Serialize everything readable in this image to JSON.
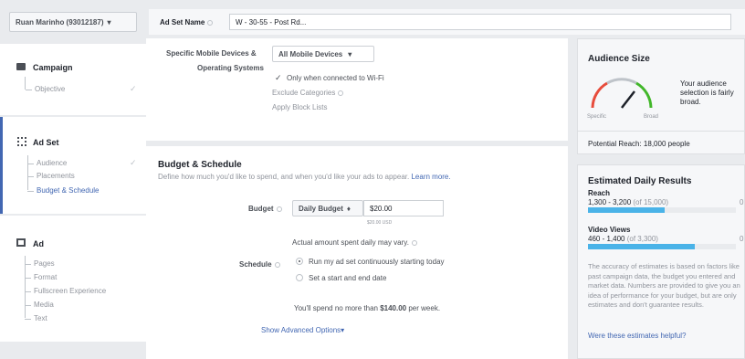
{
  "account": {
    "name": "Ruan Marinho (93012187)",
    "caret": "▾"
  },
  "header": {
    "ad_set_name_label": "Ad Set Name",
    "ad_set_name_value": "W - 30-55 - Post Rd..."
  },
  "nav": {
    "campaign": {
      "title": "Campaign",
      "children": [
        "Objective"
      ]
    },
    "adset": {
      "title": "Ad Set",
      "children": [
        "Audience",
        "Placements",
        "Budget & Schedule"
      ]
    },
    "ad": {
      "title": "Ad",
      "children": [
        "Pages",
        "Format",
        "Fullscreen Experience",
        "Media",
        "Text"
      ]
    }
  },
  "devices": {
    "label_line1": "Specific Mobile Devices &",
    "label_line2": "Operating Systems",
    "dropdown": "All Mobile Devices",
    "wifi_label": "Only when connected to Wi-Fi",
    "exclude_label": "Exclude Categories",
    "block_label": "Apply Block Lists"
  },
  "budget": {
    "title": "Budget & Schedule",
    "description": "Define how much you'd like to spend, and when you'd like your ads to appear.",
    "learn_more": "Learn more.",
    "budget_label": "Budget",
    "budget_type": "Daily Budget",
    "budget_value": "$20.00",
    "budget_sub": "$20.00 USD",
    "actual_note": "Actual amount spent daily may vary.",
    "schedule_label": "Schedule",
    "schedule_option1": "Run my ad set continuously starting today",
    "schedule_option2": "Set a start and end date",
    "weekly_prefix": "You'll spend no more than",
    "weekly_amount": "$140.00",
    "weekly_suffix": "per week.",
    "advanced": "Show Advanced Options"
  },
  "audience": {
    "title": "Audience Size",
    "gauge_specific": "Specific",
    "gauge_broad": "Broad",
    "desc": "Your audience selection is fairly broad.",
    "potential": "Potential Reach: 18,000 people"
  },
  "estimates": {
    "title": "Estimated Daily Results",
    "reach_label": "Reach",
    "reach_range": "1,300 - 3,200",
    "reach_of": "(of 15,000)",
    "reach_fill": 0.52,
    "views_label": "Video Views",
    "views_range": "460 - 1,400",
    "views_of": "(of 3,300)",
    "views_fill": 0.72,
    "edge_digit": "0",
    "accuracy": "The accuracy of estimates is based on factors like past campaign data, the budget you entered and market data. Numbers are provided to give you an idea of performance for your budget, but are only estimates and don't guarantee results.",
    "helpful": "Were these estimates helpful?"
  }
}
